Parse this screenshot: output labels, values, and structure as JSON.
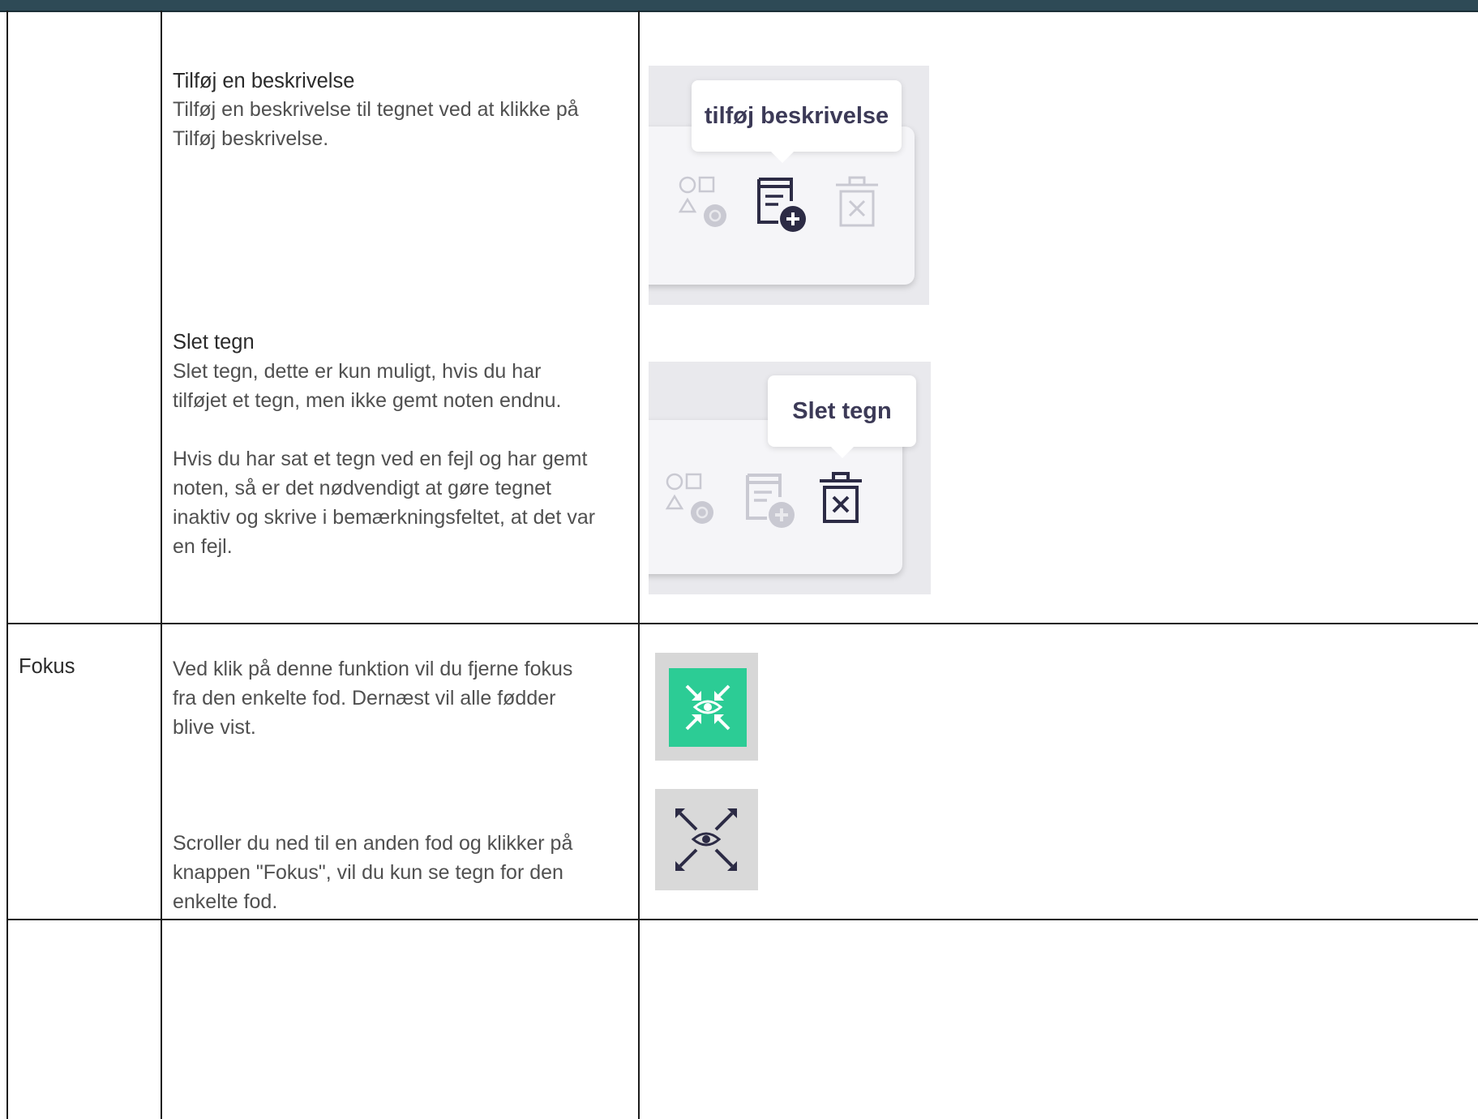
{
  "sections": {
    "add_description": {
      "heading": "Tilføj en beskrivelse",
      "lines": [
        "Tilføj en beskrivelse til tegnet ved at klikke på",
        "Tilføj beskrivelse."
      ],
      "tooltip": "tilføj beskrivelse"
    },
    "delete_sign": {
      "heading": "Slet tegn",
      "lines": [
        "Slet tegn, dette er kun muligt, hvis du har",
        "tilføjet et tegn, men ikke gemt noten endnu."
      ],
      "lines2": [
        "Hvis du har sat et tegn ved en fejl og har gemt",
        "noten, så er det nødvendigt at gøre tegnet",
        "inaktiv og skrive i bemærkningsfeltet, at det var",
        "en fejl."
      ],
      "tooltip": "Slet tegn"
    },
    "focus": {
      "label": "Fokus",
      "lines": [
        "Ved klik på denne funktion vil du fjerne fokus",
        "fra den enkelte fod. Dernæst vil alle fødder",
        "blive vist."
      ],
      "lines2": [
        "Scroller du ned til en anden fod og klikker på",
        "knappen \"Fokus\", vil du kun se tegn for den",
        "enkelte fod."
      ]
    }
  },
  "icons": {
    "shapes": "shapes-settings-icon",
    "add_description": "add-description-icon",
    "delete": "delete-sign-icon",
    "focus_active": "focus-collapse-icon",
    "focus_inactive": "focus-expand-icon"
  },
  "colors": {
    "focus_green": "#2ccc95",
    "icon_dark": "#2c2b45",
    "icon_faded": "#c9c9d2"
  }
}
